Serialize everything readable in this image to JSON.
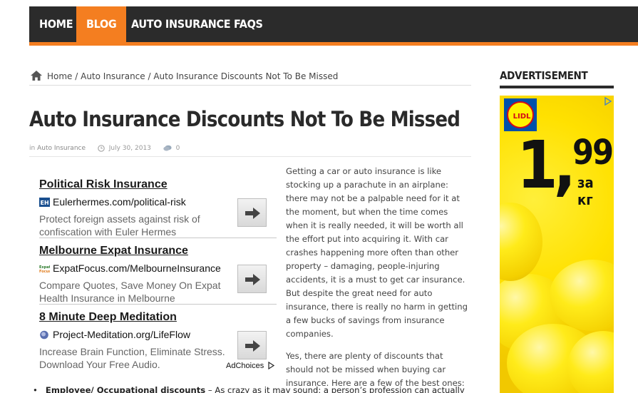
{
  "nav": {
    "items": [
      {
        "label": "HOME",
        "active": false
      },
      {
        "label": "BLOG",
        "active": true
      },
      {
        "label": "AUTO INSURANCE FAQS",
        "active": false
      }
    ],
    "accent_color": "#f47e20",
    "bar_color": "#2b2b2b"
  },
  "breadcrumb": {
    "home": "Home",
    "sep": " / ",
    "category": "Auto Insurance",
    "current": "Auto Insurance Discounts Not To Be Missed"
  },
  "post": {
    "title": "Auto Insurance Discounts Not To Be Missed",
    "meta_in": "in",
    "category": "Auto Insurance",
    "date": "July 30, 2013",
    "comments": "0",
    "paragraphs": [
      "Getting a car or auto insurance is like stocking up a parachute in an airplane: there may not be a palpable need for it at the moment, but when the time comes when it is really needed, it will be worth all the effort put into acquiring it. With car crashes happening more often than other property – damaging, people-injuring accidents, it is a must to get car insurance. But despite the great need for auto insurance, there is really no harm in getting a few bucks of savings from insurance companies.",
      "Yes, there are plenty of discounts that should not be missed when buying car insurance. Here are a few of the best ones:"
    ],
    "bullet_label": "Employee/ Occupational discounts",
    "bullet_text": " – As crazy as it may sound: a person’s profession can actually"
  },
  "ads": [
    {
      "title": "Political Risk Insurance",
      "url": "Eulerhermes.com/political-risk",
      "desc": "Protect foreign assets against risk of confiscation with Euler Hermes"
    },
    {
      "title": "Melbourne Expat Insurance",
      "url": "ExpatFocus.com/MelbourneInsurance",
      "desc": "Compare Quotes, Save Money On Expat Health Insurance in Melbourne"
    },
    {
      "title": "8 Minute Deep Meditation",
      "url": "Project-Meditation.org/LifeFlow",
      "desc": "Increase Brain Function, Eliminate Stress. Download Your Free Audio."
    }
  ],
  "adchoices": "AdChoices",
  "sidebar": {
    "heading": "ADVERTISEMENT",
    "brand": "LIDL",
    "price_main": "1,",
    "price_cents": "99",
    "price_unit": "за кг"
  }
}
